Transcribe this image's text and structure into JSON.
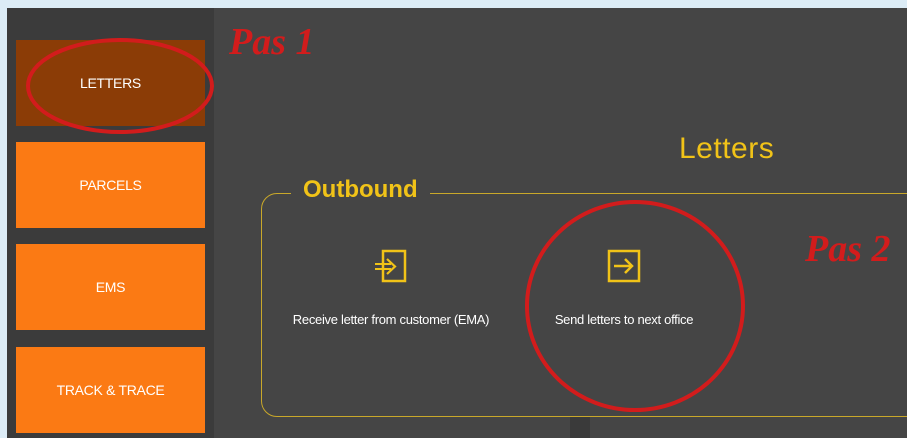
{
  "sidebar": {
    "items": [
      {
        "label": "LETTERS",
        "state": "active"
      },
      {
        "label": "PARCELS",
        "state": "normal"
      },
      {
        "label": "EMS",
        "state": "normal"
      },
      {
        "label": "TRACK & TRACE",
        "state": "normal"
      }
    ]
  },
  "page": {
    "title": "Letters"
  },
  "group": {
    "label": "Outbound"
  },
  "actions": [
    {
      "label": "Receive letter from customer (EMA)",
      "icon": "import-icon"
    },
    {
      "label": "Send letters to next office",
      "icon": "export-icon"
    }
  ],
  "annotations": {
    "step1": "Pas 1",
    "step2": "Pas 2"
  },
  "colors": {
    "accent_orange": "#fb7a14",
    "active_brown": "#8b3c06",
    "gold": "#f1c318",
    "annotation_red": "#d21c1c",
    "panel_dark": "#454545"
  }
}
